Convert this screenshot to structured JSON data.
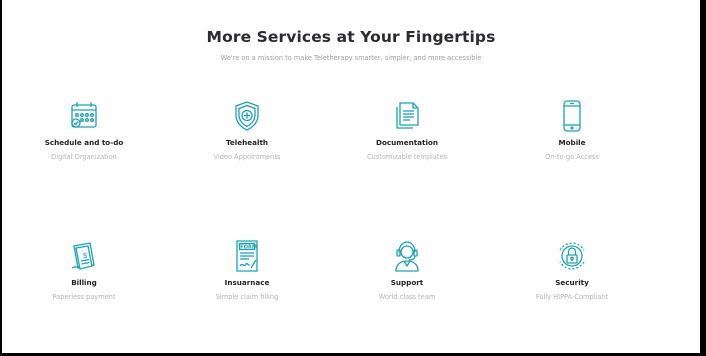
{
  "header": {
    "title": "More Services at Your Fingertips",
    "subtitle": "We're on a mission to make Teletherapy smarter, simpler, and more accessible"
  },
  "services": [
    {
      "name": "Schedule and to-do",
      "desc": "Digital Organization",
      "icon": "calendar-icon"
    },
    {
      "name": "Telehealth",
      "desc": "Video Appointments",
      "icon": "shield-medical-icon"
    },
    {
      "name": "Documentation",
      "desc": "Customizable templates",
      "icon": "documents-icon"
    },
    {
      "name": "Mobile",
      "desc": "On-to-go Access",
      "icon": "mobile-phone-icon"
    },
    {
      "name": "Billing",
      "desc": "Paperless payment",
      "icon": "invoice-icon"
    },
    {
      "name": "Insuarnace",
      "desc": "Simple claim filling",
      "icon": "form-icon"
    },
    {
      "name": "Support",
      "desc": "World class team",
      "icon": "headset-agent-icon"
    },
    {
      "name": "Security",
      "desc": "Fully HIPPA-Compliant",
      "icon": "padlock-icon"
    }
  ],
  "colors": {
    "accent": "#1aa3b8",
    "title": "#2b2b33",
    "muted": "#b0b4b8"
  }
}
